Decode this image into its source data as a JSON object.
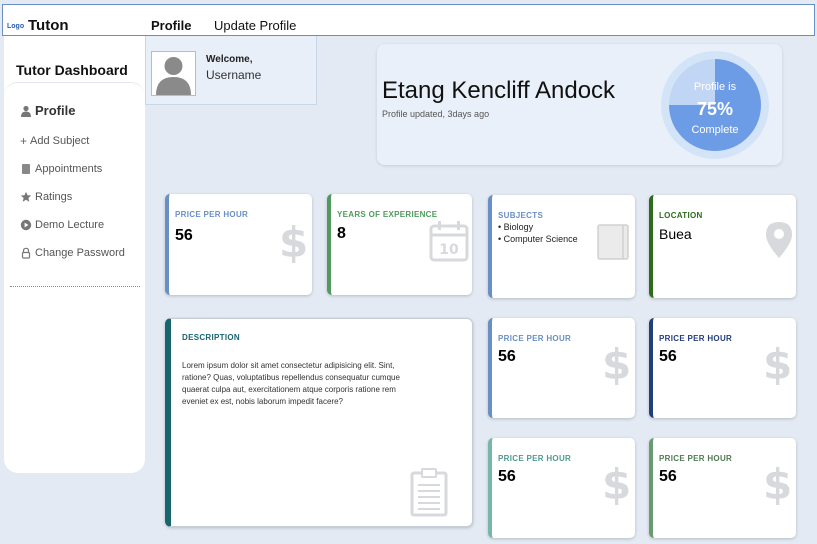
{
  "header": {
    "logo_small": "Logo",
    "brand": "Tuton",
    "tabs": [
      {
        "label": "Profile",
        "active": true
      },
      {
        "label": "Update Profile",
        "active": false
      }
    ]
  },
  "sidebar": {
    "title": "Tutor Dashboard",
    "items": [
      {
        "label": "Profile",
        "icon": "person-icon",
        "active": true
      },
      {
        "label": "Add Subject",
        "icon": "plus-icon",
        "active": false
      },
      {
        "label": "Appointments",
        "icon": "document-icon",
        "active": false
      },
      {
        "label": "Ratings",
        "icon": "star-icon",
        "active": false
      },
      {
        "label": "Demo Lecture",
        "icon": "play-icon",
        "active": false
      },
      {
        "label": "Change Password",
        "icon": "lock-icon",
        "active": false
      }
    ]
  },
  "welcome": {
    "greeting": "Welcome,",
    "username": "Username"
  },
  "profile": {
    "name": "Etang Kencliff Andock",
    "updated": "Profile updated, 3days ago",
    "completion_line1": "Profile is",
    "completion_percent_text": "75%",
    "completion_line3": "Complete",
    "completion_fraction": 0.75
  },
  "stats": {
    "price": {
      "label": "PRICE PER HOUR",
      "value": "56",
      "icon": "dollar-icon"
    },
    "experience": {
      "label": "YEARS OF EXPERIENCE",
      "value": "8",
      "icon": "calendar-icon",
      "calendar_number": "10"
    },
    "subjects": {
      "label": "SUBJECTS",
      "items": [
        "Biology",
        "Computer Science"
      ],
      "icon": "book-icon"
    },
    "location": {
      "label": "LOCATION",
      "value": "Buea",
      "icon": "location-pin-icon"
    },
    "price_2": {
      "label": "PRICE PER HOUR",
      "value": "56"
    },
    "price_3": {
      "label": "PRICE PER HOUR",
      "value": "56"
    },
    "price_4": {
      "label": "PRICE PER HOUR",
      "value": "56"
    },
    "price_5": {
      "label": "PRICE PER HOUR",
      "value": "56"
    }
  },
  "description": {
    "label": "DESCRIPTION",
    "text": "Lorem ipsum dolor sit amet consectetur adipisicing elit. Sint, ratione? Quas, voluptatibus repellendus consequatur cumque quaerat culpa aut, exercitationem atque corporis ratione rem eveniet ex est, nobis laborum impedit facere?",
    "icon": "clipboard-icon"
  },
  "colors": {
    "accent_blue": "#6a8fc4",
    "green": "#4f9a5c",
    "dark_green": "#2e6b1d",
    "navy": "#213f7a",
    "teal_dark": "#17656f",
    "teal_light": "#76b7aa",
    "sage": "#6a9a6f",
    "progress_fill": "#6d9ce6",
    "progress_track": "#c0d6f4"
  }
}
